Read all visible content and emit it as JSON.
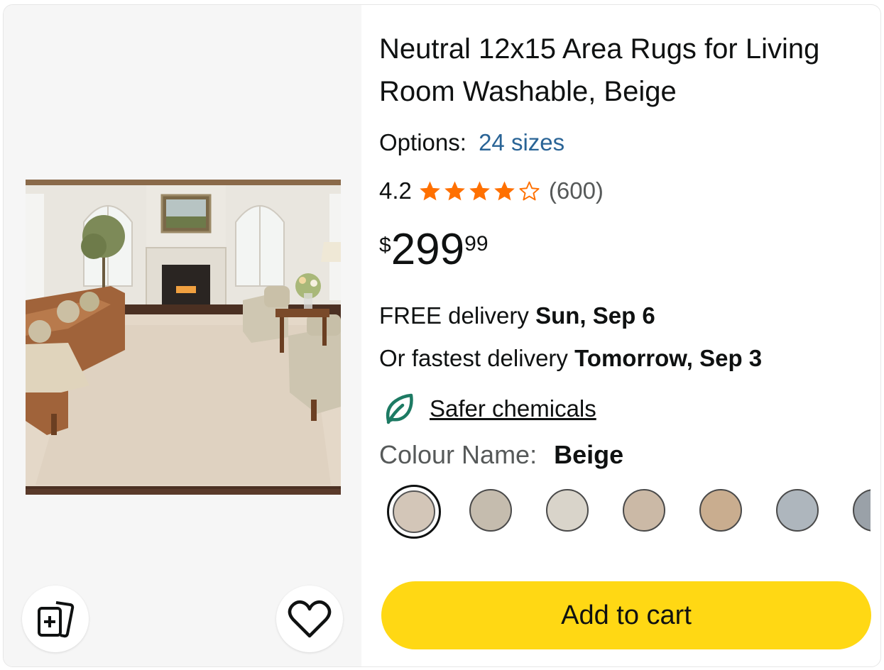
{
  "product": {
    "title": "Neutral 12x15 Area Rugs for Living Room Washable, Beige",
    "options_label": "Options:",
    "options_value": "24 sizes",
    "rating_value": "4.2",
    "rating_count": "(600)",
    "rating_stars": 4.2,
    "price_symbol": "$",
    "price_whole": "299",
    "price_fraction": "99"
  },
  "delivery": {
    "free_prefix": "FREE delivery",
    "free_date": "Sun, Sep 6",
    "fast_prefix": "Or fastest delivery",
    "fast_date": "Tomorrow, Sep 3"
  },
  "badge": {
    "icon": "leaf-icon",
    "label": "Safer chemicals",
    "color": "#1d7a63"
  },
  "colour": {
    "label": "Colour Name:",
    "value": "Beige",
    "swatches": [
      {
        "color": "#d3c6b8",
        "selected": true
      },
      {
        "color": "#c5bcae",
        "selected": false
      },
      {
        "color": "#d9d4ca",
        "selected": false
      },
      {
        "color": "#cbb9a6",
        "selected": false
      },
      {
        "color": "#c9ad8f",
        "selected": false
      },
      {
        "color": "#aeb6bd",
        "selected": false
      },
      {
        "color": "#9aa1a8",
        "selected": false
      }
    ]
  },
  "actions": {
    "add_to_cart": "Add to cart",
    "compare_icon": "compare-cards-icon",
    "wishlist_icon": "heart-icon",
    "button_color": "#ffd814",
    "star_color": "#ff7000",
    "link_color": "#2a6496"
  }
}
